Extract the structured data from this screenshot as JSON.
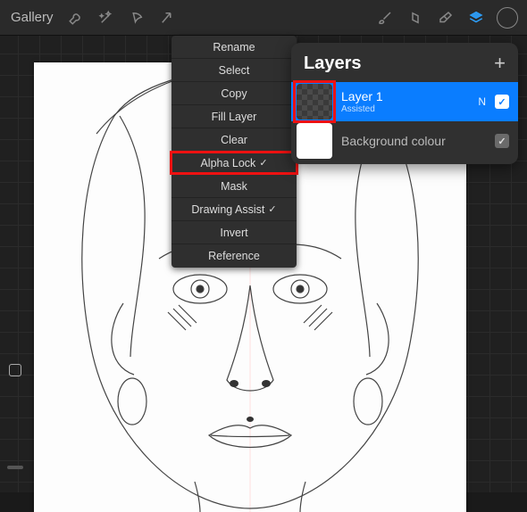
{
  "topbar": {
    "gallery": "Gallery"
  },
  "context_menu": {
    "items": [
      {
        "label": "Rename",
        "checked": false
      },
      {
        "label": "Select",
        "checked": false
      },
      {
        "label": "Copy",
        "checked": false
      },
      {
        "label": "Fill Layer",
        "checked": false
      },
      {
        "label": "Clear",
        "checked": false
      },
      {
        "label": "Alpha Lock",
        "checked": true
      },
      {
        "label": "Mask",
        "checked": false
      },
      {
        "label": "Drawing Assist",
        "checked": true
      },
      {
        "label": "Invert",
        "checked": false
      },
      {
        "label": "Reference",
        "checked": false
      }
    ]
  },
  "layers": {
    "title": "Layers",
    "items": [
      {
        "name": "Layer 1",
        "subtitle": "Assisted",
        "blend": "N",
        "visible": true,
        "selected": true,
        "thumb": "checker"
      },
      {
        "name": "Background colour",
        "subtitle": "",
        "blend": "",
        "visible": true,
        "selected": false,
        "thumb": "white"
      }
    ]
  },
  "highlights": {
    "menu_item_index": 5,
    "layer_thumb_index": 0
  },
  "colors": {
    "accent": "#0a7dff",
    "highlight": "#e11"
  }
}
